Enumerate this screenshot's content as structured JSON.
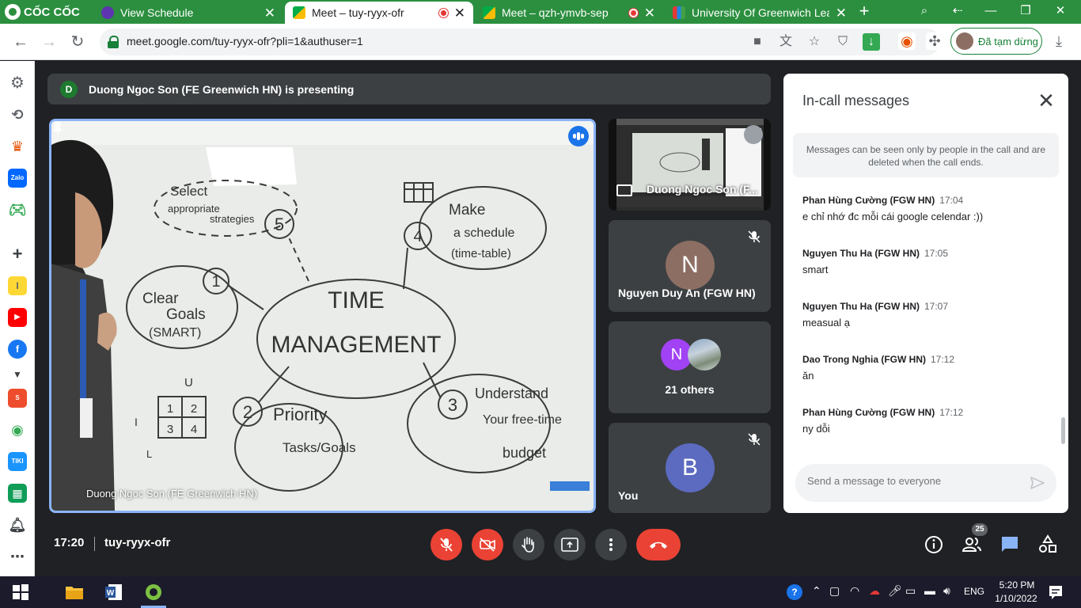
{
  "browser": {
    "brand": "CỐC CỐC",
    "tabs": [
      {
        "title": "View Schedule",
        "active": false,
        "recording": false
      },
      {
        "title": "Meet – tuy-ryyx-ofr",
        "active": true,
        "recording": true
      },
      {
        "title": "Meet – qzh-ymvb-sep",
        "active": false,
        "recording": true
      },
      {
        "title": "University Of Greenwich Lear",
        "active": false,
        "recording": false
      }
    ],
    "url": "meet.google.com/tuy-ryyx-ofr?pli=1&authuser=1",
    "profile_status": "Đã tạm dừng"
  },
  "meet": {
    "presenter_initial": "D",
    "presenting_banner": "Duong Ngoc Son (FE Greenwich HN) is presenting",
    "main_tile_name": "Duong Ngoc Son (FE Greenwich HN)",
    "whiteboard": {
      "center_line1": "TIME",
      "center_line2": "MANAGEMENT",
      "n1": "1",
      "n2": "2",
      "n3": "3",
      "n4": "4",
      "n5": "5",
      "b1_line1": "Clear",
      "b1_line2": "Goals",
      "b1_line3": "(SMART)",
      "b2_line1": "Priority",
      "b2_line2": "Tasks/Goals",
      "b3_line1": "Understand",
      "b3_line2": "Your free-time",
      "b3_line3": "budget",
      "b4_line1": "Make",
      "b4_line2": "a schedule",
      "b4_line3": "(time-table)",
      "b5_line1": "Select",
      "b5_line2": "appropriate",
      "b5_line3": "strategies",
      "matrix_cells": [
        "1",
        "2",
        "3",
        "4"
      ],
      "axis_u": "U",
      "axis_i": "I",
      "axis_l": "L"
    },
    "tiles": [
      {
        "name": "Duong Ngoc Son (F...",
        "type": "screen"
      },
      {
        "name": "Nguyen Duy An (FGW HN)",
        "initial": "N",
        "color": "#8d6e63"
      },
      {
        "name": "21 others",
        "initial": "N",
        "color": "#a142f4"
      },
      {
        "name": "You",
        "initial": "B",
        "color": "#5c6bc0"
      }
    ],
    "meeting_time": "17:20",
    "meeting_code": "tuy-ryyx-ofr",
    "participant_count": "25"
  },
  "chat": {
    "title": "In-call messages",
    "notice": "Messages can be seen only by people in the call and are deleted when the call ends.",
    "messages": [
      {
        "sender": "Phan Hùng Cường (FGW HN)",
        "time": "17:04",
        "text": "e chỉ nhớ đc mỗi cái google celendar :))"
      },
      {
        "sender": "Nguyen Thu Ha (FGW HN)",
        "time": "17:05",
        "text": "smart"
      },
      {
        "sender": "Nguyen Thu Ha (FGW HN)",
        "time": "17:07",
        "text": "measual ạ"
      },
      {
        "sender": "Dao Trong Nghia (FGW HN)",
        "time": "17:12",
        "text": "ăn"
      },
      {
        "sender": "Phan Hùng Cường (FGW HN)",
        "time": "17:12",
        "text": "ny dỗi"
      }
    ],
    "input_placeholder": "Send a message to everyone"
  },
  "taskbar": {
    "language": "ENG",
    "time": "5:20 PM",
    "date": "1/10/2022"
  },
  "colors": {
    "browser_green": "#2b8f3f",
    "meet_bg": "#202124",
    "tile_bg": "#3c4043",
    "end_call_red": "#ea4335",
    "active_speaker_blue": "#8ab4f8"
  }
}
